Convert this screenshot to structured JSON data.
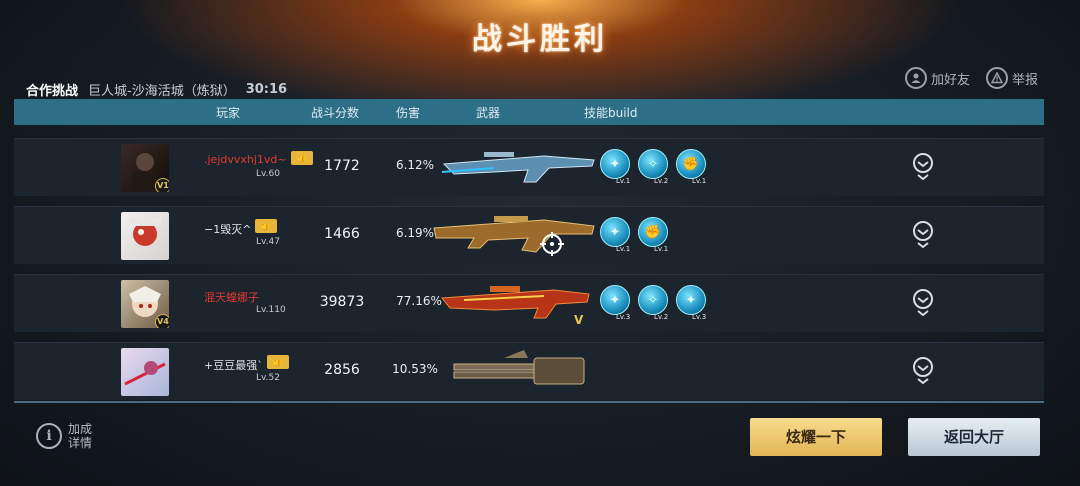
{
  "title": "战斗胜利",
  "mode": {
    "type": "合作挑战",
    "map": "巨人城-沙海活城（炼狱）",
    "time": "30:16"
  },
  "top_actions": {
    "add_friend": "加好友",
    "report": "举报"
  },
  "columns": [
    "玩家",
    "战斗分数",
    "伤害",
    "武器",
    "技能build"
  ],
  "players": [
    {
      "name": ".jejdvvxhj1vd~",
      "name_color": "red",
      "level": "Lv.60",
      "badge": "V1",
      "score": "1772",
      "damage": "6.12%",
      "weapon": "blue-rifle",
      "skills": [
        {
          "lv": "Lv.1"
        },
        {
          "lv": "Lv.2"
        },
        {
          "lv": "Lv.1"
        }
      ]
    },
    {
      "name": "−1毁灭^",
      "name_color": "white",
      "level": "Lv.47",
      "badge": "",
      "score": "1466",
      "damage": "6.19%",
      "weapon": "gold-ak",
      "skills": [
        {
          "lv": "Lv.1"
        },
        {
          "lv": "Lv.1"
        }
      ]
    },
    {
      "name": "混天蝗娜子",
      "name_color": "red",
      "level": "Lv.110",
      "badge": "V4",
      "score": "39873",
      "damage": "77.16%",
      "weapon": "red-rifle",
      "skills": [
        {
          "lv": "Lv.3"
        },
        {
          "lv": "Lv.2"
        },
        {
          "lv": "Lv.3"
        }
      ]
    },
    {
      "name": "+豆豆最强`",
      "name_color": "white",
      "level": "Lv.52",
      "badge": "",
      "score": "2856",
      "damage": "10.53%",
      "weapon": "gatling",
      "skills": []
    }
  ],
  "footer": {
    "info_line1": "加成",
    "info_line2": "详情",
    "share_button": "炫耀一下",
    "return_button": "返回大厅"
  },
  "colors": {
    "header": "#2d6f87",
    "gold_button": "#f0c66a",
    "red_name": "#e23b2e"
  }
}
